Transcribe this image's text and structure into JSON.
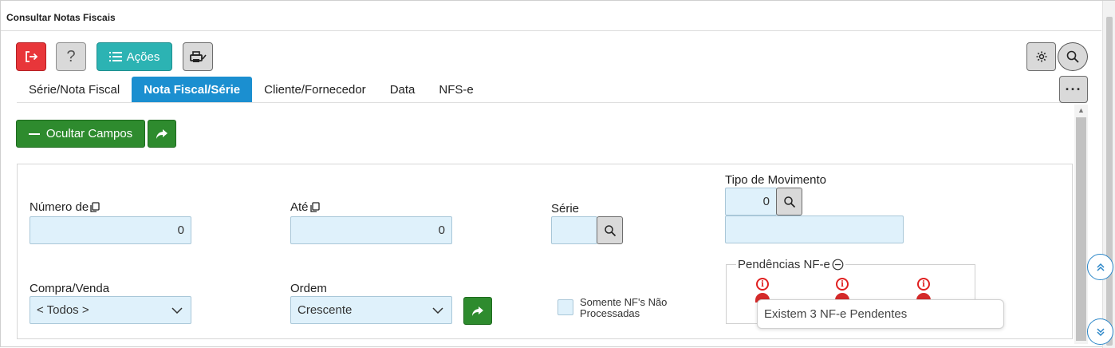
{
  "window": {
    "title": "Consultar Notas Fiscais"
  },
  "toolbar": {
    "exit_icon": "exit-icon",
    "help_label": "?",
    "acoes_label": "Ações",
    "print_icon": "print-icon",
    "settings_icon": "gear-icon",
    "search_icon": "search-icon",
    "more_label": "···"
  },
  "tabs": [
    {
      "label": "Série/Nota Fiscal",
      "active": false
    },
    {
      "label": "Nota Fiscal/Série",
      "active": true
    },
    {
      "label": "Cliente/Fornecedor",
      "active": false
    },
    {
      "label": "Data",
      "active": false
    },
    {
      "label": "NFS-e",
      "active": false
    }
  ],
  "actions": {
    "ocultar_label": "Ocultar Campos"
  },
  "form": {
    "numero_de": {
      "label": "Número de",
      "value": "0"
    },
    "ate": {
      "label": "Até",
      "value": "0"
    },
    "serie": {
      "label": "Série",
      "value": ""
    },
    "tipo_movimento": {
      "label": "Tipo de Movimento",
      "value": "0",
      "description": ""
    },
    "compra_venda": {
      "label": "Compra/Venda",
      "value": "< Todos >"
    },
    "ordem": {
      "label": "Ordem",
      "value": "Crescente"
    },
    "somente_nf": {
      "label": "Somente NF's Não Processadas",
      "checked": false
    },
    "pendencias": {
      "legend": "Pendências NF-e",
      "count": 3,
      "tooltip": "Existem 3 NF-e Pendentes"
    }
  },
  "colors": {
    "accent_blue": "#1b8fd0",
    "green": "#2e8b2e",
    "red": "#e8363a",
    "teal": "#2cb3b3",
    "field_bg": "#dff1fb"
  }
}
